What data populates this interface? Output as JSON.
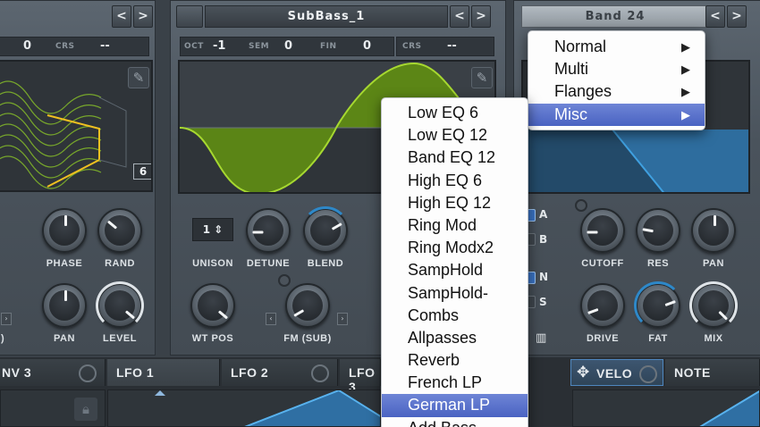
{
  "osc_a": {
    "crs_label": "CRS",
    "crs_value": "--",
    "fin_value": "0",
    "frame_value": "6",
    "knobs": {
      "phase": "PHASE",
      "rand": "RAND",
      "pan": "PAN",
      "level": "LEVEL"
    },
    "level_bracket": ")"
  },
  "osc_b": {
    "wavetable_name": "SubBass_1",
    "oct_label": "OCT",
    "oct_value": "-1",
    "sem_label": "SEM",
    "sem_value": "0",
    "fin_label": "FIN",
    "fin_value": "0",
    "crs_label": "CRS",
    "crs_value": "--",
    "unison_value": "1",
    "knobs": {
      "unison": "UNISON",
      "detune": "DETUNE",
      "blend": "BLEND",
      "wt_pos": "WT POS",
      "fm": "FM (SUB)"
    }
  },
  "filter": {
    "type_name": "Band 24",
    "knobs": {
      "cutoff": "CUTOFF",
      "res": "RES",
      "pan": "PAN",
      "drive": "DRIVE",
      "fat": "FAT",
      "mix": "MIX"
    },
    "routes": [
      "A",
      "B",
      "N",
      "S"
    ]
  },
  "nav": {
    "prev": "<",
    "next": ">"
  },
  "modbar": {
    "tabs": [
      "NV 3",
      "LFO 1",
      "LFO 2",
      "LFO 3",
      "VELO",
      "NOTE"
    ]
  },
  "filter_menu": {
    "items": [
      {
        "label": "Normal",
        "submenu": true
      },
      {
        "label": "Multi",
        "submenu": true
      },
      {
        "label": "Flanges",
        "submenu": true
      },
      {
        "label": "Misc",
        "submenu": true,
        "selected": true
      }
    ],
    "arrow": "▶"
  },
  "misc_menu": {
    "items": [
      "Low EQ 6",
      "Low EQ 12",
      "Band EQ 12",
      "High EQ 6",
      "High EQ 12",
      "Ring Mod",
      "Ring Modx2",
      "SampHold",
      "SampHold-",
      "Combs",
      "Allpasses",
      "Reverb",
      "French LP",
      "German LP",
      "Add Bass"
    ],
    "selected": "German LP"
  },
  "colors": {
    "wave_green": "#8fc21f",
    "filter_blue": "#2e88c8",
    "menu_select": "#5a72cc"
  }
}
